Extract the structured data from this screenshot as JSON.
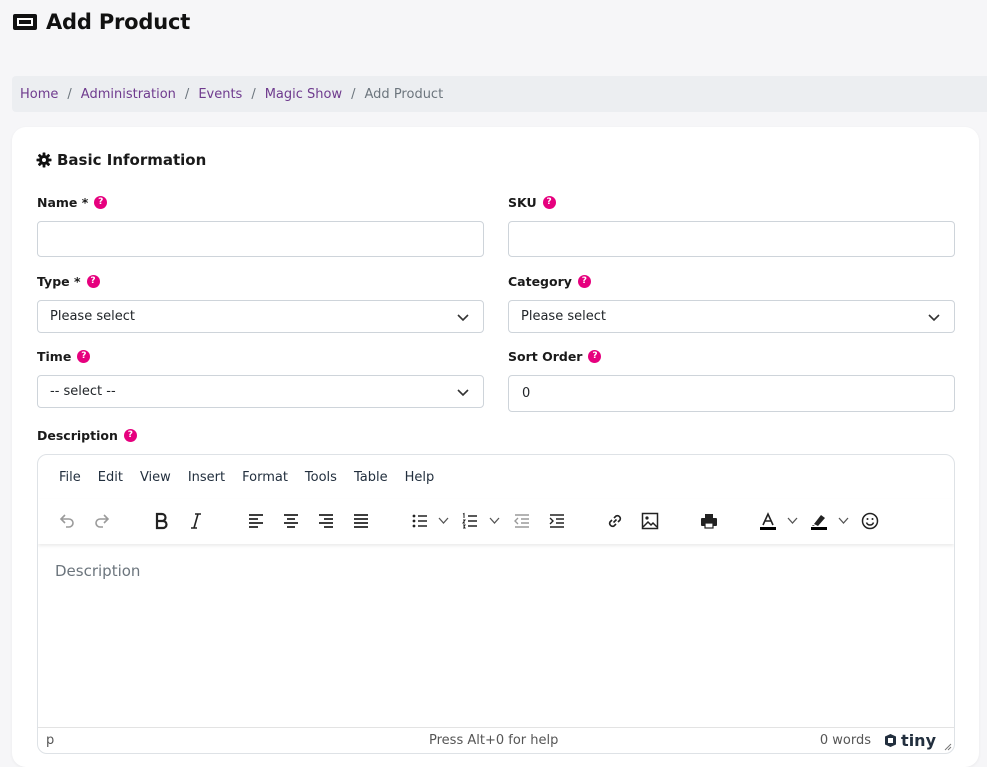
{
  "header": {
    "title": "Add Product",
    "icon": "ticket-icon"
  },
  "breadcrumb": {
    "items": [
      "Home",
      "Administration",
      "Events",
      "Magic Show"
    ],
    "current": "Add Product",
    "separator": "/"
  },
  "section": {
    "title": "Basic Information",
    "icon": "gear-icon"
  },
  "form": {
    "name": {
      "label": "Name *",
      "value": ""
    },
    "sku": {
      "label": "SKU",
      "value": ""
    },
    "type": {
      "label": "Type *",
      "selected": "Please select"
    },
    "category": {
      "label": "Category",
      "selected": "Please select"
    },
    "time": {
      "label": "Time",
      "selected": "-- select --"
    },
    "sort_order": {
      "label": "Sort Order",
      "value": "0"
    },
    "description": {
      "label": "Description"
    },
    "help_glyph": "?"
  },
  "editor": {
    "menu": [
      "File",
      "Edit",
      "View",
      "Insert",
      "Format",
      "Tools",
      "Table",
      "Help"
    ],
    "placeholder": "Description",
    "status_path": "p",
    "status_help": "Press Alt+0 for help",
    "word_count": "0 words",
    "brand": "tiny"
  },
  "colors": {
    "accent": "#6f3b8e",
    "help_badge": "#e6007e",
    "text_color_bar": "#000000"
  }
}
